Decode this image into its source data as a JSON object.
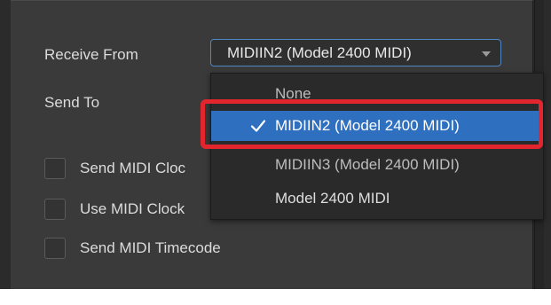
{
  "settings": {
    "receive_from_label": "Receive From",
    "receive_from_value": "MIDIIN2 (Model 2400 MIDI)",
    "send_to_label": "Send To",
    "options": [
      {
        "label": "Send MIDI Cloc",
        "checked": false
      },
      {
        "label": "Use MIDI Clock",
        "checked": false
      },
      {
        "label": "Send MIDI Timecode",
        "checked": false
      }
    ]
  },
  "dropdown": {
    "items": [
      {
        "label": "None",
        "selected": false
      },
      {
        "label": "MIDIIN2 (Model 2400 MIDI)",
        "selected": true
      },
      {
        "label": "MIDIIN3 (Model 2400 MIDI)",
        "selected": false
      },
      {
        "label": "Model 2400 MIDI",
        "selected": false
      }
    ]
  },
  "colors": {
    "panel": "#3a3a3a",
    "selection": "#2f6fbf",
    "select_border": "#4e87c6",
    "highlight": "#e3262e"
  }
}
